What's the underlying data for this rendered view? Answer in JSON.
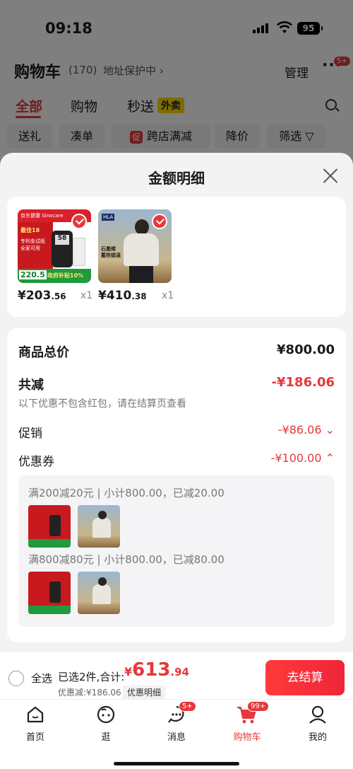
{
  "status": {
    "time": "09:18",
    "battery": "95"
  },
  "header": {
    "title": "购物车",
    "count": "(170)",
    "address_guard": "地址保护中 ›",
    "manage": "管理",
    "more": "···",
    "more_badge": "5+"
  },
  "tabs": [
    {
      "label": "全部"
    },
    {
      "label": "购物"
    },
    {
      "label": "秒送"
    }
  ],
  "waimai": "外卖",
  "chips": [
    {
      "label": "送礼"
    },
    {
      "label": "凑单"
    },
    {
      "label": "跨店满减",
      "tag": "促"
    },
    {
      "label": "降价"
    },
    {
      "label": "筛选 ▽"
    }
  ],
  "sheet": {
    "title": "金额明细",
    "products": [
      {
        "price_int": "¥203",
        "price_dec": ".56",
        "qty": "x1",
        "brand": "京东健康 Sinocare",
        "promo": "政府补贴10%",
        "badge_price": "220.5",
        "label": "专利金试纸 全家可用",
        "tag": "最佳18"
      },
      {
        "price_int": "¥410",
        "price_dec": ".38",
        "qty": "x1",
        "brand": "HLA",
        "label": "石墨烯 蓄热锁温"
      }
    ],
    "total_label": "商品总价",
    "total_value": "¥800.00",
    "reduce_label": "共减",
    "reduce_value": "-¥186.06",
    "note": "以下优惠不包含红包，请在结算页查看",
    "promo_label": "促销",
    "promo_value": "-¥86.06 ⌄",
    "coupon_label": "优惠券",
    "coupon_value": "-¥100.00 ⌃",
    "coupons": [
      {
        "text": "满200减20元 | 小计800.00，已减20.00"
      },
      {
        "text": "满800减80元 | 小计800.00，已减80.00"
      }
    ]
  },
  "bottom": {
    "select_all": "全选",
    "selected": "已选2件,合计:",
    "currency": "¥",
    "total_int": "613",
    "total_dec": ".94",
    "discount": "优惠减:¥186.06",
    "detail": "优惠明细",
    "checkout": "去结算"
  },
  "nav": [
    {
      "label": "首页",
      "icon": "home-icon"
    },
    {
      "label": "逛",
      "icon": "face-icon"
    },
    {
      "label": "消息",
      "icon": "message-icon",
      "badge": "5+"
    },
    {
      "label": "购物车",
      "icon": "cart-icon",
      "badge": "99+"
    },
    {
      "label": "我的",
      "icon": "user-icon"
    }
  ],
  "colors": {
    "accent": "#e4393c",
    "sheet_bg": "#f3f3f3"
  }
}
